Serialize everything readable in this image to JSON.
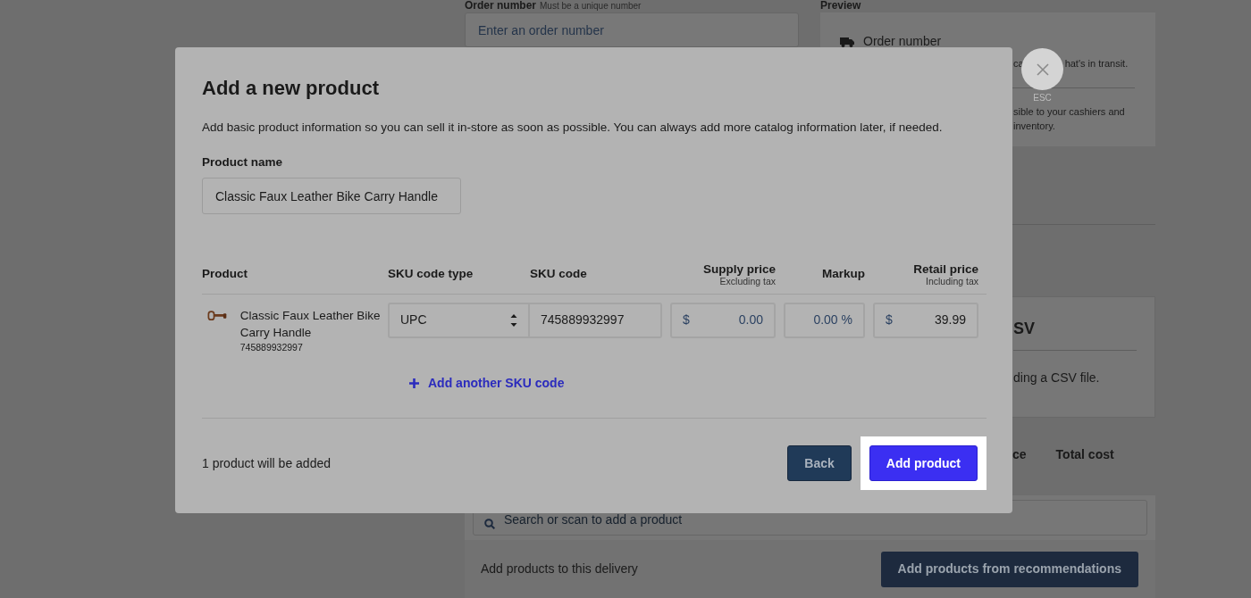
{
  "background": {
    "order_label": "Order number",
    "order_hint": "Must be a unique number",
    "order_placeholder": "Enter an order number",
    "preview_title": "Preview",
    "preview_heading": "Order number",
    "preview_fragments": [
      "ca",
      "hat's in transit."
    ],
    "preview_lines": [
      "sible to your cashiers and",
      "inventory."
    ],
    "csv_heading": "SV",
    "csv_text": "ding a CSV file.",
    "columns": [
      "ce",
      "Total cost"
    ],
    "search_placeholder": "Search or scan to add a product",
    "footer_text": "Add products to this delivery",
    "recommend_button": "Add products from recommendations"
  },
  "close": {
    "label": "ESC"
  },
  "modal": {
    "title": "Add a new product",
    "description": "Add basic product information so you can sell it in-store as soon as possible. You can always add more catalog information later, if needed.",
    "name_label": "Product name",
    "name_value": "Classic Faux Leather Bike Carry Handle",
    "columns": [
      {
        "label": "Product"
      },
      {
        "label": "SKU code type"
      },
      {
        "label": "SKU code"
      },
      {
        "label": "Supply price",
        "sublabel": "Excluding tax"
      },
      {
        "label": "Markup"
      },
      {
        "label": "Retail price",
        "sublabel": "Including tax"
      }
    ],
    "rows": [
      {
        "name": "Classic Faux Leather Bike Carry Handle",
        "sku": "745889932997",
        "sku_type": "UPC",
        "sku_code": "745889932997",
        "supply_currency": "$",
        "supply_price": "0.00",
        "markup": "0.00",
        "markup_unit": "%",
        "retail_currency": "$",
        "retail_price": "39.99"
      }
    ],
    "add_sku": "Add another SKU code",
    "summary": "1 product will be added",
    "buttons": [
      {
        "label": "Back",
        "kind": "secondary",
        "highlighted": false
      },
      {
        "label": "Add product",
        "kind": "primary",
        "highlighted": true
      }
    ]
  }
}
